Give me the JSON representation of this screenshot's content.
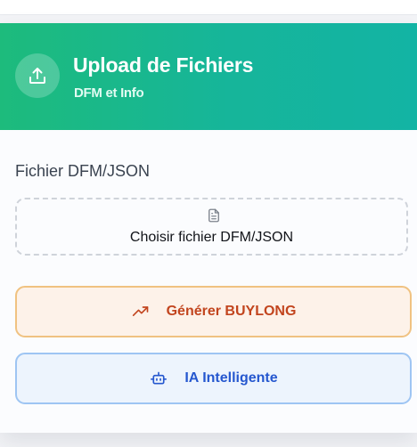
{
  "header": {
    "title": "Upload de Fichiers",
    "subtitle": "DFM et Info",
    "icon": "upload-icon",
    "gradient": [
      "#1dbb7c",
      "#13b4a4"
    ]
  },
  "file_section": {
    "label": "Fichier DFM/JSON",
    "choose_label": "Choisir fichier DFM/JSON",
    "icon": "file-icon"
  },
  "actions": {
    "buylong_label": "Générer BUYLONG",
    "buylong_icon": "trending-up-icon",
    "ia_label": "IA Intelligente",
    "ia_icon": "bot-icon"
  }
}
